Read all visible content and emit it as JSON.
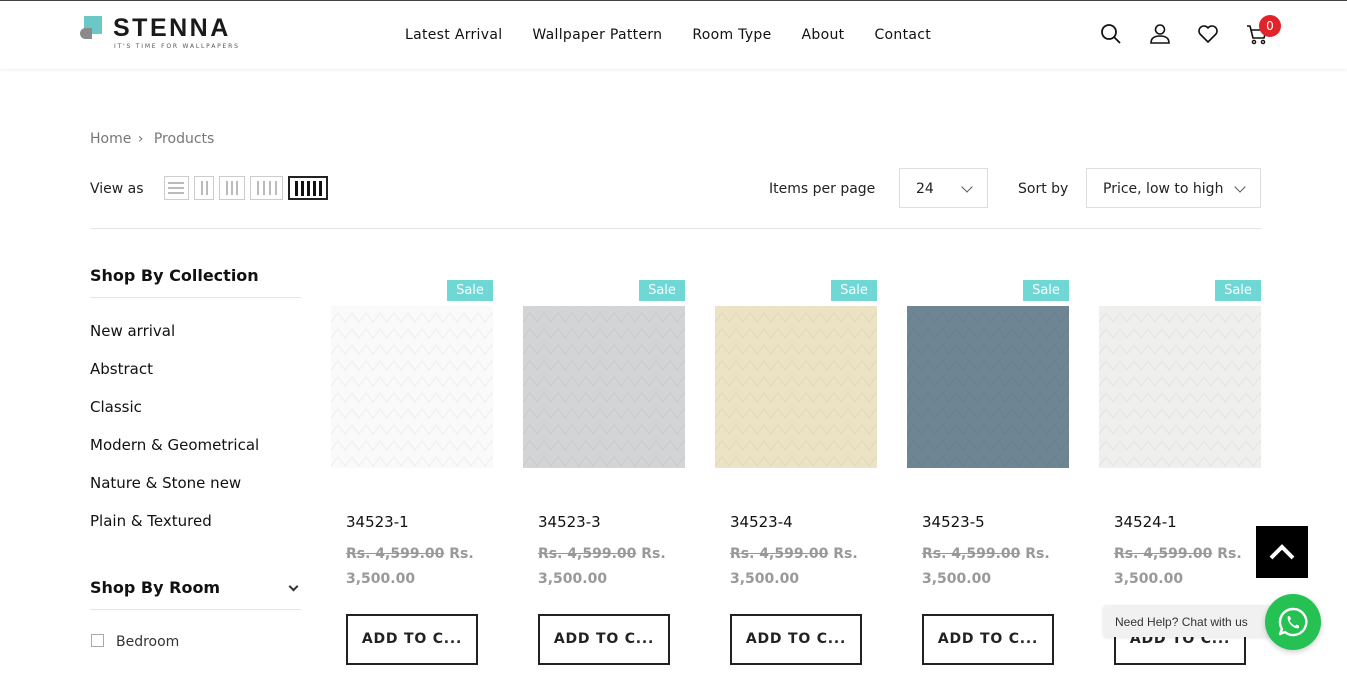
{
  "brand": {
    "name": "STENNA",
    "tagline": "IT'S TIME FOR WALLPAPERS"
  },
  "nav": [
    "Latest Arrival",
    "Wallpaper Pattern",
    "Room Type",
    "About",
    "Contact"
  ],
  "header_icons": [
    "search-icon",
    "user-icon",
    "heart-icon",
    "cart-icon"
  ],
  "cart": {
    "count": "0"
  },
  "breadcrumb": {
    "home": "Home",
    "separator": "›",
    "current": "Products"
  },
  "toolbar": {
    "view_as_label": "View as",
    "view_options": [
      "list",
      "2-columns",
      "3-columns",
      "4-columns",
      "5-columns"
    ],
    "active_view": "5-columns",
    "items_per_page_label": "Items per page",
    "items_per_page_value": "24",
    "sort_label": "Sort by",
    "sort_value": "Price, low to high"
  },
  "sidebar": {
    "collection_title": "Shop By Collection",
    "collections": [
      "New arrival",
      "Abstract",
      "Classic",
      "Modern & Geometrical",
      "Nature & Stone new",
      "Plain & Textured"
    ],
    "room_title": "Shop By Room",
    "rooms": [
      {
        "label": "Bedroom",
        "checked": false
      }
    ]
  },
  "products": [
    {
      "name": "34523-1",
      "badge": "Sale",
      "old_price": "Rs. 4,599.00",
      "price_line1": "Rs.",
      "price_line2": "3,500.00",
      "button": "ADD TO C...",
      "color": "#fafafa"
    },
    {
      "name": "34523-3",
      "badge": "Sale",
      "old_price": "Rs. 4,599.00",
      "price_line1": "Rs.",
      "price_line2": "3,500.00",
      "button": "ADD TO C...",
      "color": "#d2d4d6"
    },
    {
      "name": "34523-4",
      "badge": "Sale",
      "old_price": "Rs. 4,599.00",
      "price_line1": "Rs.",
      "price_line2": "3,500.00",
      "button": "ADD TO C...",
      "color": "#ece3c5"
    },
    {
      "name": "34523-5",
      "badge": "Sale",
      "old_price": "Rs. 4,599.00",
      "price_line1": "Rs.",
      "price_line2": "3,500.00",
      "button": "ADD TO C...",
      "color": "#6e8694"
    },
    {
      "name": "34524-1",
      "badge": "Sale",
      "old_price": "Rs. 4,599.00",
      "price_line1": "Rs.",
      "price_line2": "3,500.00",
      "button": "ADD TO C...",
      "color": "#efefed"
    }
  ],
  "chat": {
    "text": "Need Help? Chat with us"
  },
  "colors": {
    "sale_badge": "#6fd8d5",
    "cart_badge": "#e0242a",
    "whatsapp": "#25c153",
    "brand_accent": "#6cc7c7"
  }
}
